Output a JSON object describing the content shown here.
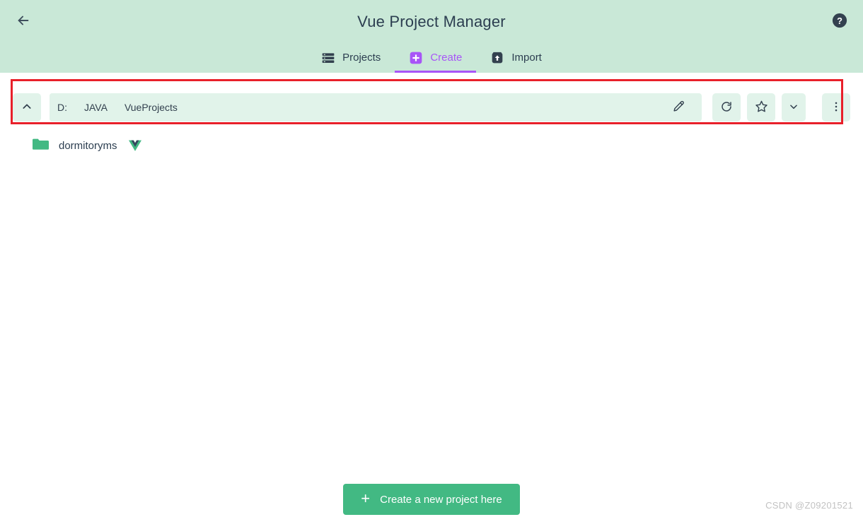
{
  "window": {
    "title": "Vue Project Manager"
  },
  "header": {
    "back_icon": "arrow-left-icon",
    "help_icon": "help-circle-icon",
    "tabs": [
      {
        "label": "Projects",
        "icon": "server-list-icon",
        "active": false
      },
      {
        "label": "Create",
        "icon": "plus-square-icon",
        "active": true
      },
      {
        "label": "Import",
        "icon": "upload-box-icon",
        "active": false
      }
    ]
  },
  "pathbar": {
    "up_icon": "chevron-up-icon",
    "crumbs": [
      "D:",
      "JAVA",
      "VueProjects"
    ],
    "edit_icon": "pencil-icon",
    "refresh_icon": "refresh-icon",
    "favorite_icon": "star-icon",
    "dropdown_icon": "chevron-down-icon",
    "more_icon": "more-vertical-icon"
  },
  "files": {
    "items": [
      {
        "name": "dormitoryms",
        "icon": "folder-icon",
        "badge": "vue-logo-icon"
      }
    ]
  },
  "footer": {
    "create_label": "Create a new project here",
    "create_plus": "+"
  },
  "watermark": {
    "text": "CSDN @Z09201521"
  },
  "colors": {
    "header_bg": "#c9e8d7",
    "pathbar_bg": "#e1f3ea",
    "accent_purple": "#a855f7",
    "accent_green": "#42b983",
    "annotation_red": "#e8202a",
    "text_dark": "#2c3e50"
  }
}
